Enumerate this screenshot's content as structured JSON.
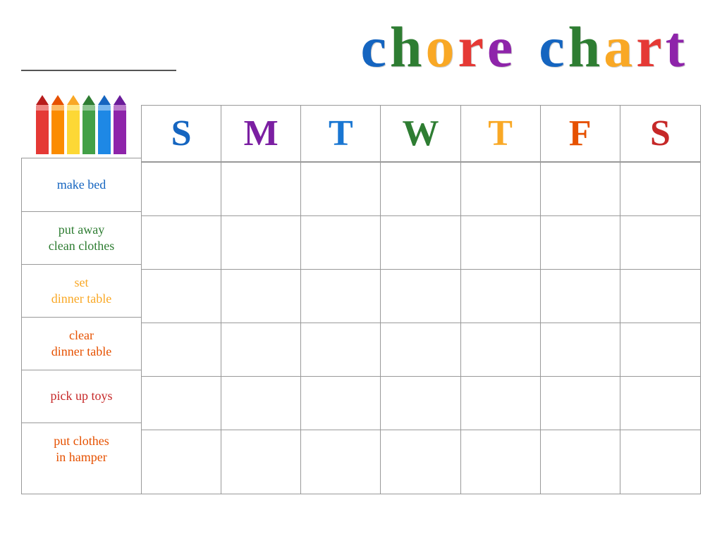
{
  "header": {
    "title": "chore chart",
    "name_line_label": "Name line"
  },
  "days": {
    "headers": [
      {
        "label": "S",
        "color": "#1565C0"
      },
      {
        "label": "M",
        "color": "#7B1FA2"
      },
      {
        "label": "T",
        "color": "#1976D2"
      },
      {
        "label": "W",
        "color": "#2E7D32"
      },
      {
        "label": "T",
        "color": "#F9A825"
      },
      {
        "label": "F",
        "color": "#E65100"
      },
      {
        "label": "S",
        "color": "#C62828"
      }
    ]
  },
  "chores": [
    {
      "label": "make bed",
      "color": "#1565C0"
    },
    {
      "label": "put away\nclean clothes",
      "color": "#2E7D32"
    },
    {
      "label": "set\ndinner table",
      "color": "#F9A825"
    },
    {
      "label": "clear\ndinner table",
      "color": "#E65100"
    },
    {
      "label": "pick up toys",
      "color": "#C62828"
    },
    {
      "label": "put clothes\nin hamper",
      "color": "#E65100"
    }
  ],
  "crayons": [
    {
      "color": "#E53935",
      "tip_color": "#B71C1C"
    },
    {
      "color": "#FB8C00",
      "tip_color": "#E65100"
    },
    {
      "color": "#FDD835",
      "tip_color": "#F9A825"
    },
    {
      "color": "#43A047",
      "tip_color": "#2E7D32"
    },
    {
      "color": "#1E88E5",
      "tip_color": "#1565C0"
    },
    {
      "color": "#8E24AA",
      "tip_color": "#6A1B9A"
    }
  ]
}
